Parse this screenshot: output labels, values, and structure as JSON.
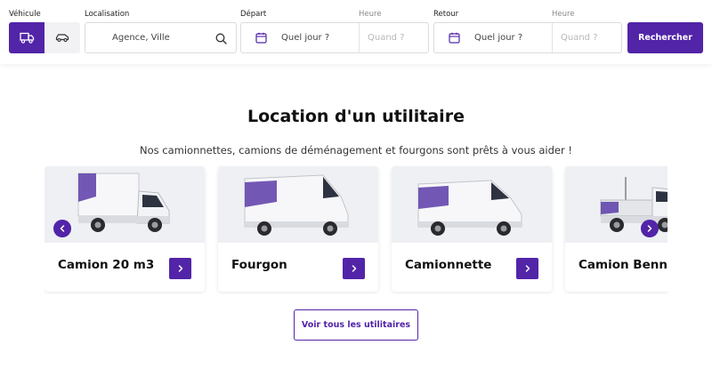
{
  "search": {
    "vehicle_label": "Véhicule",
    "location_label": "Localisation",
    "location_placeholder": "Agence, Ville",
    "departure_label": "Départ",
    "departure_time_label": "Heure",
    "departure_date_placeholder": "Quel jour ?",
    "departure_time_placeholder": "Quand ?",
    "return_label": "Retour",
    "return_time_label": "Heure",
    "return_date_placeholder": "Quel jour ?",
    "return_time_placeholder": "Quand ?",
    "search_button": "Rechercher",
    "vehicle_options": [
      {
        "icon": "truck-icon",
        "selected": true
      },
      {
        "icon": "car-icon",
        "selected": false
      }
    ]
  },
  "main": {
    "title": "Location d'un utilitaire",
    "subtitle": "Nos camionnettes, camions de déménagement et fourgons sont prêts à vous aider !",
    "cards": [
      {
        "name": "Camion 20 m3",
        "image": "box-truck"
      },
      {
        "name": "Fourgon",
        "image": "high-roof-van"
      },
      {
        "name": "Camionnette",
        "image": "van"
      },
      {
        "name": "Camion Benne",
        "image": "tipper-truck"
      }
    ],
    "view_all_button": "Voir tous les utilitaires"
  },
  "colors": {
    "accent": "#5224a8",
    "card_image_bg": "#eef0f4"
  }
}
